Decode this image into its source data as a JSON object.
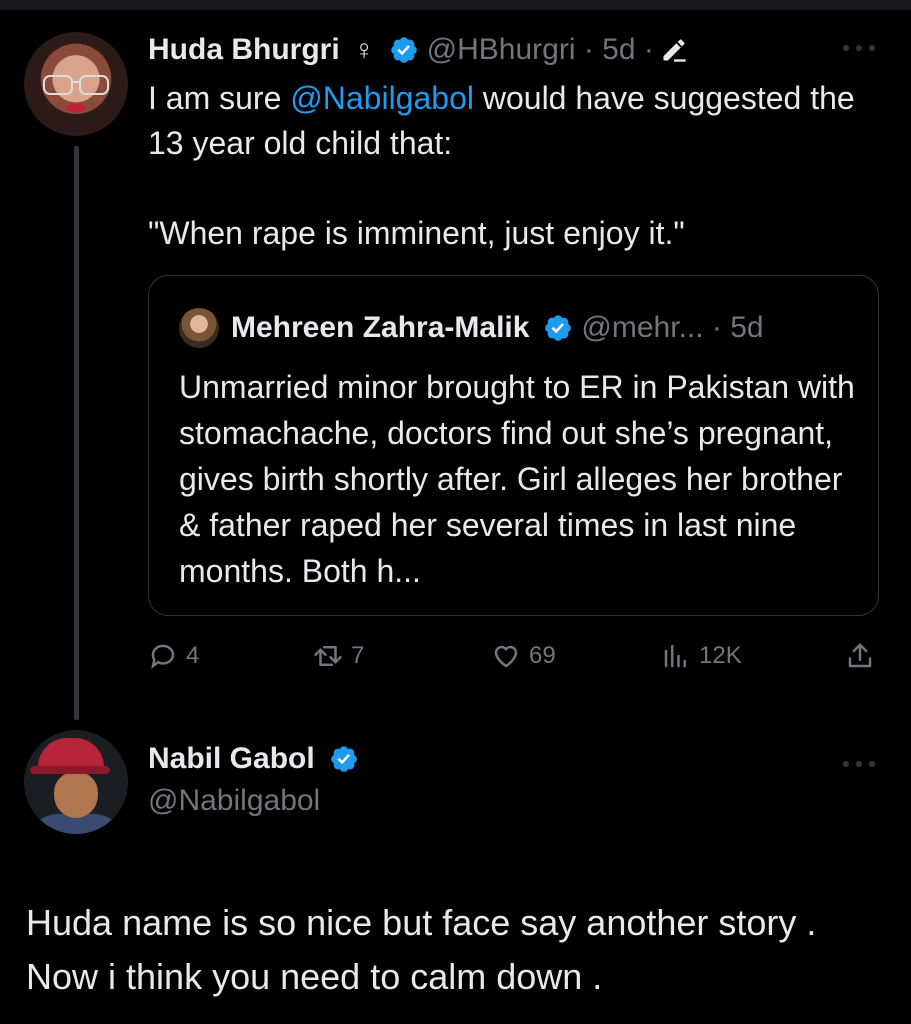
{
  "colors": {
    "background": "#000000",
    "text": "#e7e9ea",
    "muted": "#71767b",
    "accent": "#1d9bf0",
    "border": "#2f3336"
  },
  "tweet1": {
    "display_name": "Huda Bhurgri",
    "gender_symbol": "♀",
    "handle_meta": "@HBhurgri · 5d ·",
    "text_line_prefix": "I am sure ",
    "mention": "@Nabilgabol",
    "text_line_suffix": " would have suggested the 13 year old child that:",
    "text_quote": "\"When rape is imminent, just enjoy it.\"",
    "quoted": {
      "display_name": "Mehreen Zahra-Malik",
      "handle_meta": "@mehr... · 5d",
      "text": "Unmarried minor brought to ER in Pakistan with stomachache, doctors find out she’s pregnant, gives birth shortly after. Girl alleges her brother & father raped her several times in last nine months. Both h..."
    },
    "actions": {
      "replies": "4",
      "retweets": "7",
      "likes": "69",
      "views": "12K"
    }
  },
  "tweet2": {
    "display_name": "Nabil Gabol",
    "handle": "@Nabilgabol",
    "text": "Huda name is so nice but face say another story . Now i think you need to calm down ."
  },
  "icons": [
    "verified-badge-icon",
    "edit-pencil-icon",
    "more-icon",
    "reply-icon",
    "retweet-icon",
    "like-icon",
    "views-icon",
    "share-icon"
  ]
}
